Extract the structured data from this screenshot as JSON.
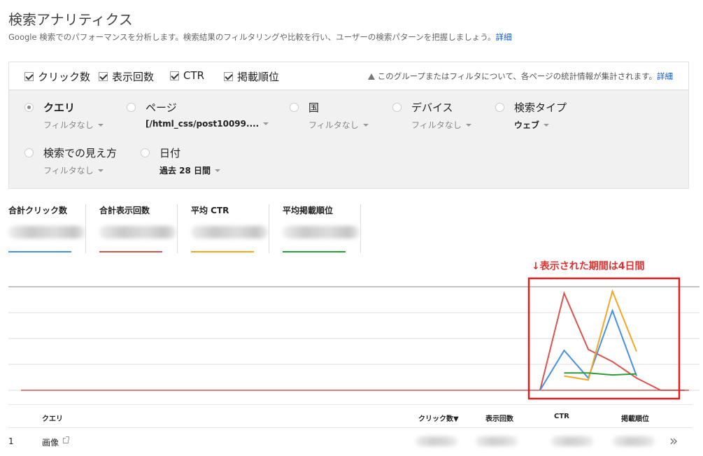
{
  "page": {
    "title": "検索アナリティクス",
    "subtitle": "Google 検索でのパフォーマンスを分析します。検索結果のフィルタリングや比較を行い、ユーザーの検索パターンを把握しましょう。",
    "subtitle_link": "詳細"
  },
  "metrics_toggle": {
    "items": [
      {
        "label": "クリック数",
        "checked": true
      },
      {
        "label": "表示回数",
        "checked": true
      },
      {
        "label": "CTR",
        "checked": true
      },
      {
        "label": "掲載順位",
        "checked": true
      }
    ],
    "notice": "このグループまたはフィルタについて、各ページの統計情報が集計されます。",
    "notice_link": "詳細"
  },
  "dimensions": [
    {
      "label": "クエリ",
      "selected": true,
      "filter": "フィルタなし"
    },
    {
      "label": "ページ",
      "selected": false,
      "filter": "[/html_css/post10099...."
    },
    {
      "label": "国",
      "selected": false,
      "filter": "フィルタなし"
    },
    {
      "label": "デバイス",
      "selected": false,
      "filter": "フィルタなし"
    },
    {
      "label": "検索タイプ",
      "selected": false,
      "filter": "ウェブ"
    },
    {
      "label": "検索での見え方",
      "selected": false,
      "filter": "フィルタなし"
    },
    {
      "label": "日付",
      "selected": false,
      "filter": "過去 28 日間"
    }
  ],
  "summary": [
    {
      "label": "合計クリック数",
      "color": "#4a90e2"
    },
    {
      "label": "合計表示回数",
      "color": "#d9534f"
    },
    {
      "label": "平均 CTR",
      "color": "#f5a623"
    },
    {
      "label": "平均掲載順位",
      "color": "#2a9d3a"
    }
  ],
  "annotation": "↓表示された期間は4日間",
  "chart_data": {
    "type": "line",
    "x": [
      1,
      2,
      3,
      4,
      5,
      6,
      7
    ],
    "series": [
      {
        "color": "#d9534f",
        "values": [
          0,
          0.95,
          0.4,
          0.28,
          0.12,
          0,
          0
        ]
      },
      {
        "color": "#4a90e2",
        "values": [
          0,
          0.39,
          0.12,
          0.78,
          0.14,
          null,
          null
        ]
      },
      {
        "color": "#f5a623",
        "values": [
          null,
          0.14,
          0.1,
          0.97,
          0.38,
          null,
          null
        ]
      },
      {
        "color": "#2a9d3a",
        "values": [
          null,
          0.17,
          0.17,
          0.15,
          0.16,
          null,
          null
        ]
      }
    ],
    "grid": true
  },
  "table": {
    "headers": {
      "query": "クエリ",
      "clicks": "クリック数▼",
      "impressions": "表示回数",
      "ctr": "CTR",
      "position": "掲載順位"
    },
    "rows": [
      {
        "index": "1",
        "query": "画像"
      }
    ],
    "next": "»"
  }
}
